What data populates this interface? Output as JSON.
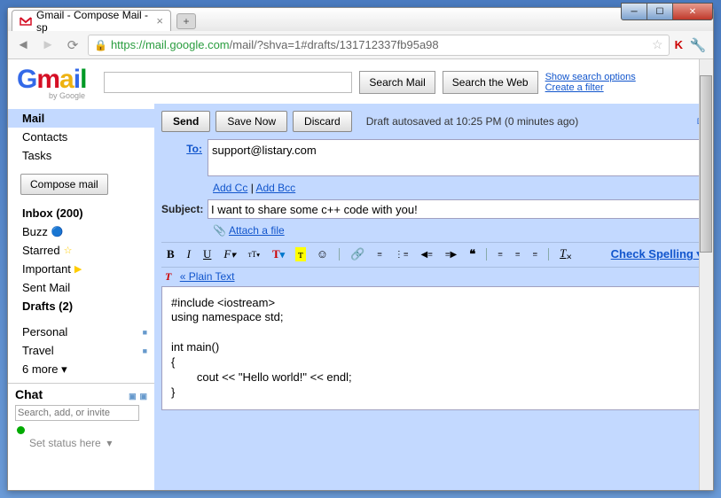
{
  "window": {
    "tab_title": "Gmail - Compose Mail - sp",
    "url_host": "https://mail.google.com",
    "url_path": "/mail/?shva=1#drafts/131712337fb95a98"
  },
  "header": {
    "search_mail": "Search Mail",
    "search_web": "Search the Web",
    "show_options": "Show search options",
    "create_filter": "Create a filter"
  },
  "sidebar": {
    "mail": "Mail",
    "contacts": "Contacts",
    "tasks": "Tasks",
    "compose": "Compose mail",
    "inbox": "Inbox (200)",
    "buzz": "Buzz",
    "starred": "Starred",
    "important": "Important",
    "sent": "Sent Mail",
    "drafts": "Drafts (2)",
    "personal": "Personal",
    "travel": "Travel",
    "more": "6 more ▾",
    "chat": "Chat",
    "chat_placeholder": "Search, add, or invite",
    "status": "Set status here"
  },
  "compose": {
    "send": "Send",
    "save_now": "Save Now",
    "discard": "Discard",
    "autosave": "Draft autosaved at 10:25 PM (0 minutes ago)",
    "to_label": "To:",
    "to_value": "support@listary.com",
    "add_cc": "Add Cc",
    "add_bcc": "Add Bcc",
    "subject_label": "Subject:",
    "subject_value": "I want to share some c++ code with you!",
    "attach": "Attach a file",
    "check_spelling": "Check Spelling ▾",
    "plain_text": "« Plain Text",
    "body": "#include <iostream>\nusing namespace std;\n\nint main()\n{\n        cout << \"Hello world!\" << endl;\n}"
  }
}
